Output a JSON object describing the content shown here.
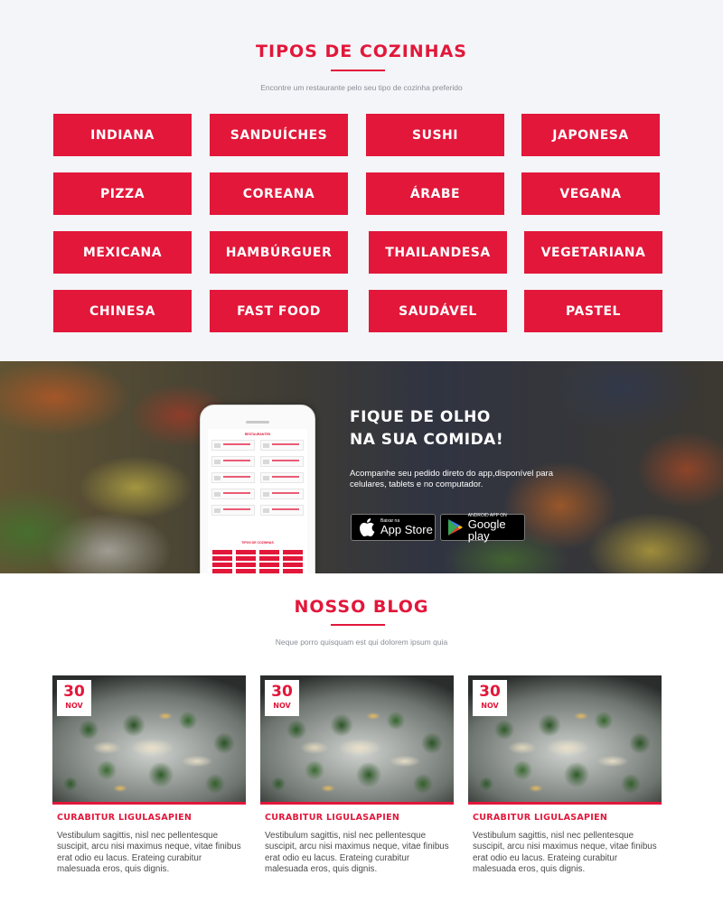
{
  "cuisines": {
    "title": "TIPOS DE COZINHAS",
    "subtitle": "Encontre um restaurante pelo seu tipo de cozinha preferido",
    "items": [
      "INDIANA",
      "SANDUÍCHES",
      "SUSHI",
      "JAPONESA",
      "PIZZA",
      "COREANA",
      "ÁRABE",
      "VEGANA",
      "MEXICANA",
      "HAMBÚRGUER",
      "THAILANDESA",
      "VEGETARIANA",
      "CHINESA",
      "FAST FOOD",
      "SAUDÁVEL",
      "PASTEL"
    ]
  },
  "app_promo": {
    "title_line1": "FIQUE DE OLHO",
    "title_line2": "NA SUA COMIDA!",
    "text": "Acompanhe seu pedido direto do app,disponível para celulares, tablets e no computador.",
    "app_store": {
      "small": "Baixar na",
      "big": "App Store",
      "icon": "apple-icon"
    },
    "google_play": {
      "small": "ANDROID APP ON",
      "big": "Google play",
      "icon": "play-icon"
    },
    "phone_screen": {
      "header": "RESTAURANTES",
      "section": "TIPOS DE COZINHAS"
    }
  },
  "blog": {
    "title": "NOSSO BLOG",
    "subtitle": "Neque porro quisquam est qui dolorem ipsum quia",
    "posts": [
      {
        "day": "30",
        "month": "NOV",
        "title": "CURABITUR LIGULASAPIEN",
        "body": "Vestibulum sagittis, nisl nec pellentesque suscipit, arcu nisi maximus neque, vitae finibus erat odio eu lacus. Erateing curabitur malesuada eros, quis dignis."
      },
      {
        "day": "30",
        "month": "NOV",
        "title": "CURABITUR LIGULASAPIEN",
        "body": "Vestibulum sagittis, nisl nec pellentesque suscipit, arcu nisi maximus neque, vitae finibus erat odio eu lacus. Erateing curabitur malesuada eros, quis dignis."
      },
      {
        "day": "30",
        "month": "NOV",
        "title": "CURABITUR LIGULASAPIEN",
        "body": "Vestibulum sagittis, nisl nec pellentesque suscipit, arcu nisi maximus neque, vitae finibus erat odio eu lacus. Erateing curabitur malesuada eros, quis dignis."
      }
    ]
  },
  "colors": {
    "accent": "#e2173a",
    "section_bg": "#f4f5f8"
  }
}
